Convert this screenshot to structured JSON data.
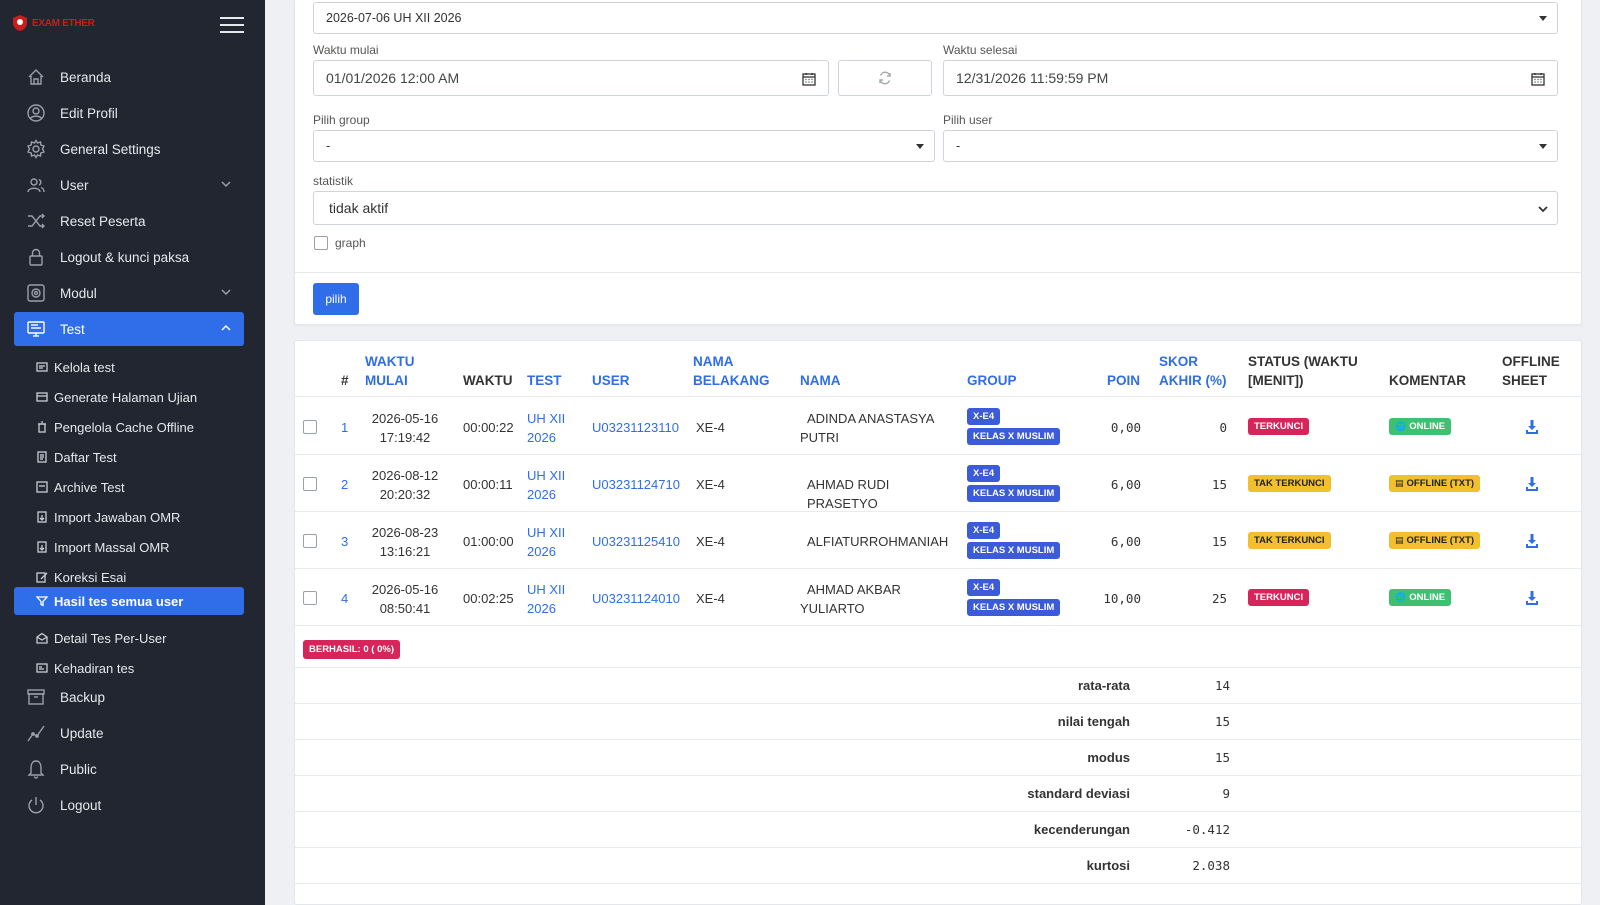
{
  "app": {
    "brand": "EXAM ETHER"
  },
  "sidebar": {
    "main_items": [
      {
        "label": "Beranda",
        "icon": "home-icon"
      },
      {
        "label": "Edit Profil",
        "icon": "user-circle-icon"
      },
      {
        "label": "General Settings",
        "icon": "gear-icon"
      },
      {
        "label": "User",
        "icon": "users-icon"
      },
      {
        "label": "Reset Peserta",
        "icon": "shuffle-icon"
      },
      {
        "label": "Logout & kunci paksa",
        "icon": "lock-icon"
      },
      {
        "label": "Modul",
        "icon": "module-icon"
      },
      {
        "label": "Test",
        "icon": "monitor-icon"
      }
    ],
    "sub_items": [
      {
        "label": "Kelola test"
      },
      {
        "label": "Generate Halaman Ujian"
      },
      {
        "label": "Pengelola Cache Offline"
      },
      {
        "label": "Daftar Test"
      },
      {
        "label": "Archive Test"
      },
      {
        "label": "Import Jawaban OMR"
      },
      {
        "label": "Import Massal OMR"
      },
      {
        "label": "Koreksi Esai"
      },
      {
        "label": "Hasil tes semua user"
      },
      {
        "label": "Detail Tes Per-User"
      },
      {
        "label": "Kehadiran tes"
      }
    ],
    "bottom_items": [
      {
        "label": "Backup",
        "icon": "archive-icon"
      },
      {
        "label": "Update",
        "icon": "trend-icon"
      },
      {
        "label": "Public",
        "icon": "bell-icon"
      },
      {
        "label": "Logout",
        "icon": "power-icon"
      }
    ]
  },
  "filter": {
    "test_select": "2026-07-06 UH XII 2026",
    "start_label": "Waktu mulai",
    "start_value": "01/01/2026 12:00 AM",
    "end_label": "Waktu selesai",
    "end_value": "12/31/2026 11:59:59 PM",
    "group_label": "Pilih group",
    "group_value": "-",
    "user_label": "Pilih user",
    "user_value": "-",
    "stat_label": "statistik",
    "stat_value": "tidak aktif",
    "graph_label": "graph",
    "submit_label": "pilih"
  },
  "table": {
    "headers": {
      "num": "#",
      "start_1": "WAKTU",
      "start_2": "MULAI",
      "time": "WAKTU",
      "test": "TEST",
      "user": "USER",
      "lastname_1": "NAMA",
      "lastname_2": "BELAKANG",
      "name": "NAMA",
      "group": "GROUP",
      "points": "POIN",
      "score_1": "SKOR",
      "score_2": "AKHIR (%)",
      "status_1": "STATUS (WAKTU",
      "status_2": "[MENIT])",
      "comment": "KOMENTAR",
      "offline_1": "OFFLINE",
      "offline_2": "SHEET"
    },
    "rows": [
      {
        "num": "1",
        "date": "2026-05-16",
        "clock": "17:19:42",
        "time": "00:00:22",
        "test_1": "UH XII",
        "test_2": "2026",
        "user": "U03231123110",
        "lastname": "XE-4",
        "name_1": "ADINDA ANASTASYA",
        "name_2": "PUTRI",
        "group_1": "X-E4",
        "group_2": "KELAS X MUSLIM",
        "points": "0,00",
        "score": "0",
        "status": "TERKUNCI",
        "status_color": "red",
        "comment": "ONLINE",
        "comment_color": "green"
      },
      {
        "num": "2",
        "date": "2026-08-12",
        "clock": "20:20:32",
        "time": "00:00:11",
        "test_1": "UH XII",
        "test_2": "2026",
        "user": "U03231124710",
        "lastname": "XE-4",
        "name_1": "AHMAD RUDI PRASETYO",
        "name_2": "",
        "group_1": "X-E4",
        "group_2": "KELAS X MUSLIM",
        "points": "6,00",
        "score": "15",
        "status": "TAK TERKUNCI",
        "status_color": "yellow",
        "comment": "OFFLINE (TXT)",
        "comment_color": "yellow"
      },
      {
        "num": "3",
        "date": "2026-08-23",
        "clock": "13:16:21",
        "time": "01:00:00",
        "test_1": "UH XII",
        "test_2": "2026",
        "user": "U03231125410",
        "lastname": "XE-4",
        "name_1": "ALFIATURROHMANIAH",
        "name_2": "",
        "group_1": "X-E4",
        "group_2": "KELAS X MUSLIM",
        "points": "6,00",
        "score": "15",
        "status": "TAK TERKUNCI",
        "status_color": "yellow",
        "comment": "OFFLINE (TXT)",
        "comment_color": "yellow"
      },
      {
        "num": "4",
        "date": "2026-05-16",
        "clock": "08:50:41",
        "time": "00:02:25",
        "test_1": "UH XII",
        "test_2": "2026",
        "user": "U03231124010",
        "lastname": "XE-4",
        "name_1": "AHMAD AKBAR",
        "name_2": "YULIARTO",
        "group_1": "X-E4",
        "group_2": "KELAS X MUSLIM",
        "points": "10,00",
        "score": "25",
        "status": "TERKUNCI",
        "status_color": "red",
        "comment": "ONLINE",
        "comment_color": "green"
      }
    ],
    "success_badge": "BERHASIL: 0 ( 0%)",
    "stats": [
      {
        "label": "rata-rata",
        "value": "14"
      },
      {
        "label": "nilai tengah",
        "value": "15"
      },
      {
        "label": "modus",
        "value": "15"
      },
      {
        "label": "standard deviasi",
        "value": "9"
      },
      {
        "label": "kecenderungan",
        "value": "-0.412"
      },
      {
        "label": "kurtosi",
        "value": "2.038"
      }
    ]
  },
  "colors": {
    "sidebar_bg": "#212631",
    "accent": "#2f6ee8",
    "red": "#d7245a",
    "yellow": "#f2c02f",
    "green": "#3fbf72",
    "group_blue": "#3b5bd8"
  }
}
